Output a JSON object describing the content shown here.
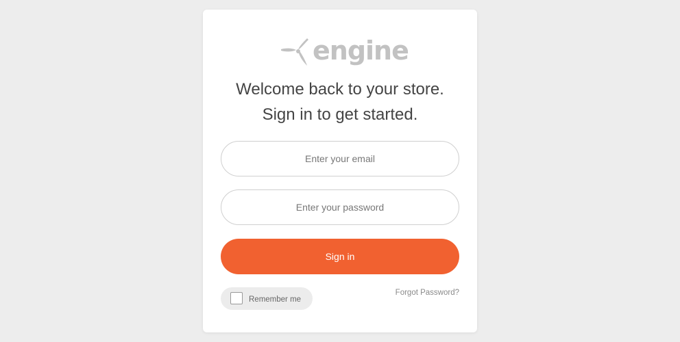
{
  "brand": {
    "name": "engine",
    "logo_icon": "engine-propeller-icon",
    "logo_color": "#c2c2c2"
  },
  "headline": {
    "line1": "Welcome back to your store.",
    "line2": "Sign in to get started."
  },
  "form": {
    "email": {
      "value": "",
      "placeholder": "Enter your email"
    },
    "password": {
      "value": "",
      "placeholder": "Enter your password"
    },
    "submit_label": "Sign in",
    "remember_label": "Remember me",
    "remember_checked": false,
    "forgot_label": "Forgot Password?"
  },
  "colors": {
    "accent": "#f16130",
    "page_background": "#ededed",
    "card_background": "#ffffff"
  }
}
